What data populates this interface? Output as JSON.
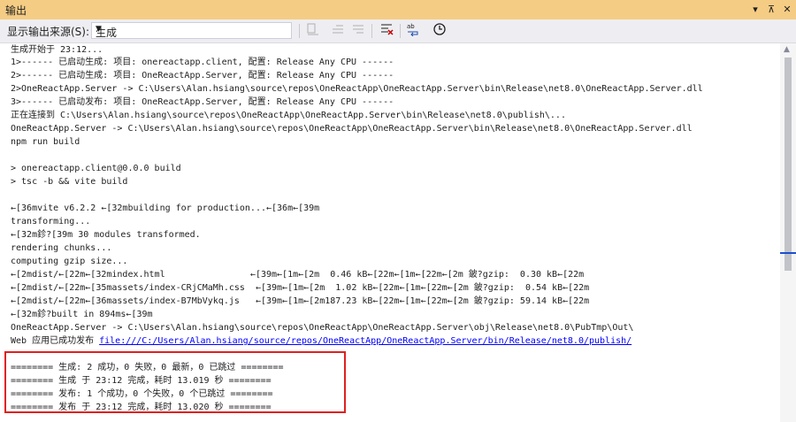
{
  "window": {
    "title": "输出",
    "dropdown_icon": "▾",
    "pin_icon": "⊼",
    "close_icon": "✕"
  },
  "toolbar": {
    "source_label": "显示输出来源(S):",
    "source_value": "生成",
    "icons": [
      "find-message-icon",
      "previous-message-icon",
      "next-message-icon",
      "clear-all-icon",
      "word-wrap-icon",
      "timestamp-icon"
    ]
  },
  "output": {
    "lines": [
      "生成开始于 23:12...",
      "1>------ 已启动生成: 项目: onereactapp.client, 配置: Release Any CPU ------",
      "2>------ 已启动生成: 项目: OneReactApp.Server, 配置: Release Any CPU ------",
      "2>OneReactApp.Server -> C:\\Users\\Alan.hsiang\\source\\repos\\OneReactApp\\OneReactApp.Server\\bin\\Release\\net8.0\\OneReactApp.Server.dll",
      "3>------ 已启动发布: 项目: OneReactApp.Server, 配置: Release Any CPU ------",
      "正在连接到 C:\\Users\\Alan.hsiang\\source\\repos\\OneReactApp\\OneReactApp.Server\\bin\\Release\\net8.0\\publish\\...",
      "OneReactApp.Server -> C:\\Users\\Alan.hsiang\\source\\repos\\OneReactApp\\OneReactApp.Server\\bin\\Release\\net8.0\\OneReactApp.Server.dll",
      "npm run build",
      "",
      "> onereactapp.client@0.0.0 build",
      "> tsc -b && vite build",
      "",
      "←[36mvite v6.2.2 ←[32mbuilding for production...←[36m←[39m",
      "transforming...",
      "←[32m鉁?[39m 30 modules transformed.",
      "rendering chunks...",
      "computing gzip size...",
      "←[2mdist/←[22m←[32mindex.html                ←[39m←[1m←[2m  0.46 kB←[22m←[1m←[22m←[2m 鈹?gzip:  0.30 kB←[22m",
      "←[2mdist/←[22m←[35massets/index-CRjCMaMh.css  ←[39m←[1m←[2m  1.02 kB←[22m←[1m←[22m←[2m 鈹?gzip:  0.54 kB←[22m",
      "←[2mdist/←[22m←[36massets/index-B7MbVykq.js   ←[39m←[1m←[2m187.23 kB←[22m←[1m←[22m←[2m 鈹?gzip: 59.14 kB←[22m",
      "←[32m鉁?built in 894ms←[39m",
      "OneReactApp.Server -> C:\\Users\\Alan.hsiang\\source\\repos\\OneReactApp\\OneReactApp.Server\\obj\\Release\\net8.0\\PubTmp\\Out\\"
    ],
    "publish_prefix": "Web 应用已成功发布 ",
    "publish_link": "file:///C:/Users/Alan.hsiang/source/repos/OneReactApp/OneReactApp.Server/bin/Release/net8.0/publish/",
    "blank": "",
    "summary": [
      "======== 生成: 2 成功，0 失败，0 最新，0 已跳过 ========",
      "======== 生成 于 23:12 完成，耗时 13.019 秒 ========",
      "======== 发布: 1 个成功，0 个失败，0 个已跳过 ========",
      "======== 发布 于 23:12 完成，耗时 13.020 秒 ========"
    ]
  }
}
